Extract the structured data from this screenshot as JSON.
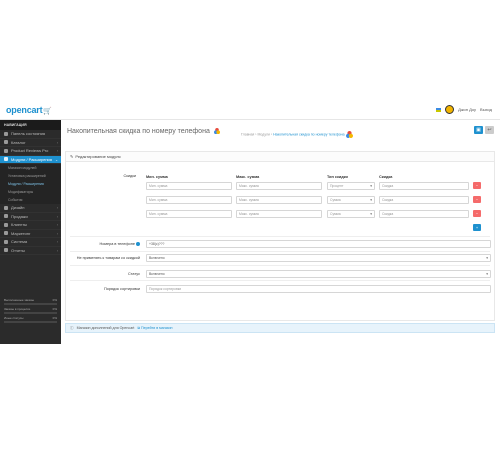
{
  "header": {
    "logo_text": "opencart",
    "user_name": "Джон Доу",
    "logout_label": "Выход"
  },
  "sidebar": {
    "nav_head": "НАВИГАЦИЯ",
    "items": [
      {
        "label": "Панель состояния"
      },
      {
        "label": "Каталог"
      },
      {
        "label": "Product Reviews Pro"
      },
      {
        "label": "Модули / Расширения"
      }
    ],
    "subitems": [
      {
        "label": "Магазин модулей"
      },
      {
        "label": "Установка расширений"
      },
      {
        "label": "Модули / Расширения"
      },
      {
        "label": "Модификаторы"
      },
      {
        "label": "События"
      }
    ],
    "items2": [
      {
        "label": "Дизайн"
      },
      {
        "label": "Продажи"
      },
      {
        "label": "Клиенты"
      },
      {
        "label": "Маркетинг"
      },
      {
        "label": "Система"
      },
      {
        "label": "Отчеты"
      }
    ],
    "progress": [
      {
        "label": "Выполненные заказы",
        "value": "0%",
        "fraction": 0.0
      },
      {
        "label": "Заказы в процессе",
        "value": "0%",
        "fraction": 0.0
      },
      {
        "label": "Иные статусы",
        "value": "0%",
        "fraction": 0.0
      }
    ]
  },
  "main": {
    "page_title": "Накопительная скидка по номеру телефона",
    "breadcrumb": [
      "Главная",
      "Модули",
      "Накопительная скидка по номеру телефона"
    ],
    "panel_title": "Редактирование модуля",
    "discounts_label": "Скидки",
    "columns": [
      "Мин. сумма",
      "Макс. сумма",
      "Тип скидки",
      "Скидка"
    ],
    "rows": [
      {
        "min": "Мин. сумма",
        "max": "Макс. сумма",
        "type": "Процент",
        "discount": "Скидка"
      },
      {
        "min": "Мин. сумма",
        "max": "Макс. сумма",
        "type": "Сумма",
        "discount": "Скидка"
      },
      {
        "min": "Мин. сумма",
        "max": "Макс. сумма",
        "type": "Сумма",
        "discount": "Скидка"
      }
    ],
    "phone_label": "Номера в телефоне",
    "phone_value": "+38(c)???",
    "other_label": "Не применять к товарам со скидкой",
    "other_value": "Включено",
    "status_label": "Статус",
    "status_value": "Включено",
    "sort_label": "Порядок сортировки",
    "sort_placeholder": "Порядок сортировки",
    "footer_text": "Магазин дополнений для Opencart",
    "footer_link": "Перейти в магазин"
  },
  "colors": {
    "accent": "#1e91cf",
    "danger": "#f56b6b",
    "sidebar": "#2b2b2b"
  }
}
